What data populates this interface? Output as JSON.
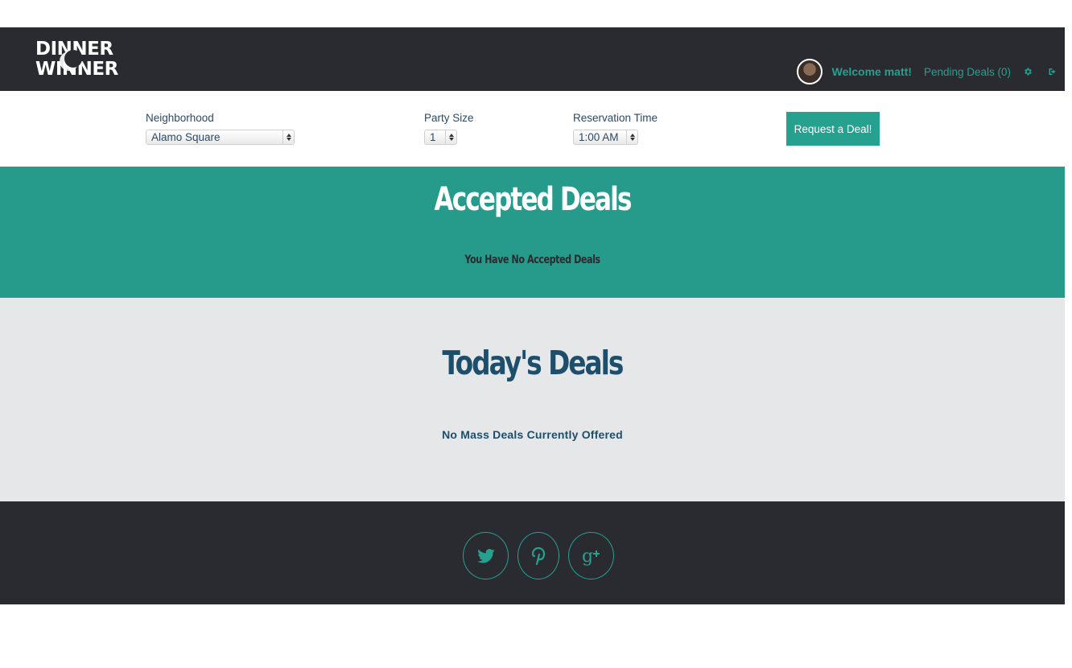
{
  "colors": {
    "dark": "#2a2b30",
    "accent": "#26a08f",
    "accepted_bg": "#269b8b",
    "today_bg": "#e6e7e8",
    "navy": "#1d4e6b"
  },
  "header": {
    "logo_line1": "DINNER",
    "logo_line2": "WINNER",
    "welcome": "Welcome matt!",
    "pending_deals": "Pending Deals (0)",
    "icons": [
      "avatar",
      "gear-icon",
      "sign-out-icon"
    ]
  },
  "form": {
    "neighborhood": {
      "label": "Neighborhood",
      "value": "Alamo Square"
    },
    "party_size": {
      "label": "Party Size",
      "value": "1"
    },
    "reservation_time": {
      "label": "Reservation Time",
      "value": "1:00 AM"
    },
    "request_button": "Request a Deal!"
  },
  "accepted": {
    "title": "Accepted Deals",
    "empty_message": "You Have No Accepted Deals"
  },
  "today": {
    "title": "Today's Deals",
    "empty_message": "No Mass Deals Currently Offered"
  },
  "footer": {
    "social_icons": [
      "twitter-icon",
      "pinterest-icon",
      "google-plus-icon"
    ]
  }
}
